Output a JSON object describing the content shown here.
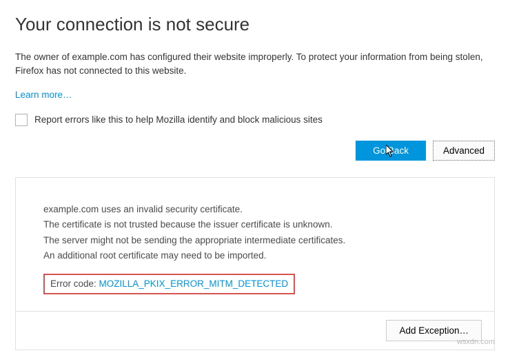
{
  "title": "Your connection is not secure",
  "description": "The owner of example.com has configured their website improperly. To protect your information from being stolen, Firefox has not connected to this website.",
  "learn_more": "Learn more…",
  "checkbox_label": "Report errors like this to help Mozilla identify and block malicious sites",
  "buttons": {
    "go_back": "Go Back",
    "advanced": "Advanced"
  },
  "details": {
    "cert_invalid": "example.com uses an invalid security certificate.",
    "reason1": "The certificate is not trusted because the issuer certificate is unknown.",
    "reason2": "The server might not be sending the appropriate intermediate certificates.",
    "reason3": "An additional root certificate may need to be imported.",
    "error_label": "Error code: ",
    "error_code": "MOZILLA_PKIX_ERROR_MITM_DETECTED",
    "add_exception": "Add Exception…"
  },
  "watermark": "wsxdn.com"
}
